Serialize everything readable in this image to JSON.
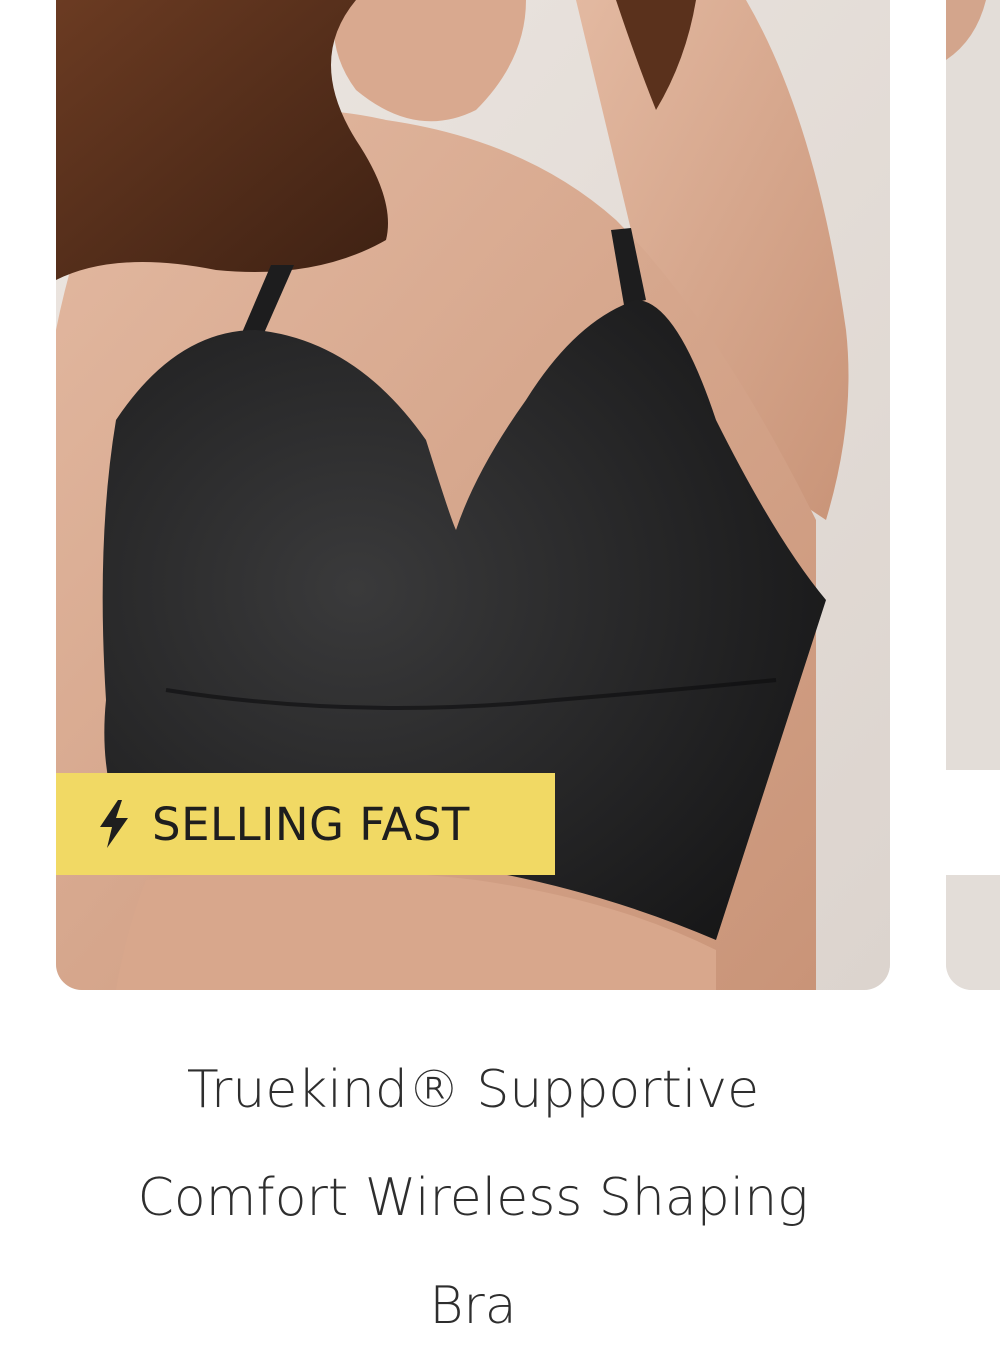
{
  "product": {
    "image_alt": "model-wearing-black-wireless-bra",
    "badge": {
      "icon": "lightning-bolt-icon",
      "label": "SELLING FAST",
      "color": "#f1d964"
    },
    "title": "Truekind® Supportive Comfort Wireless Shaping Bra"
  },
  "colors": {
    "badge_bg": "#f1d964",
    "text": "#2e2e2e",
    "background": "#ffffff"
  }
}
